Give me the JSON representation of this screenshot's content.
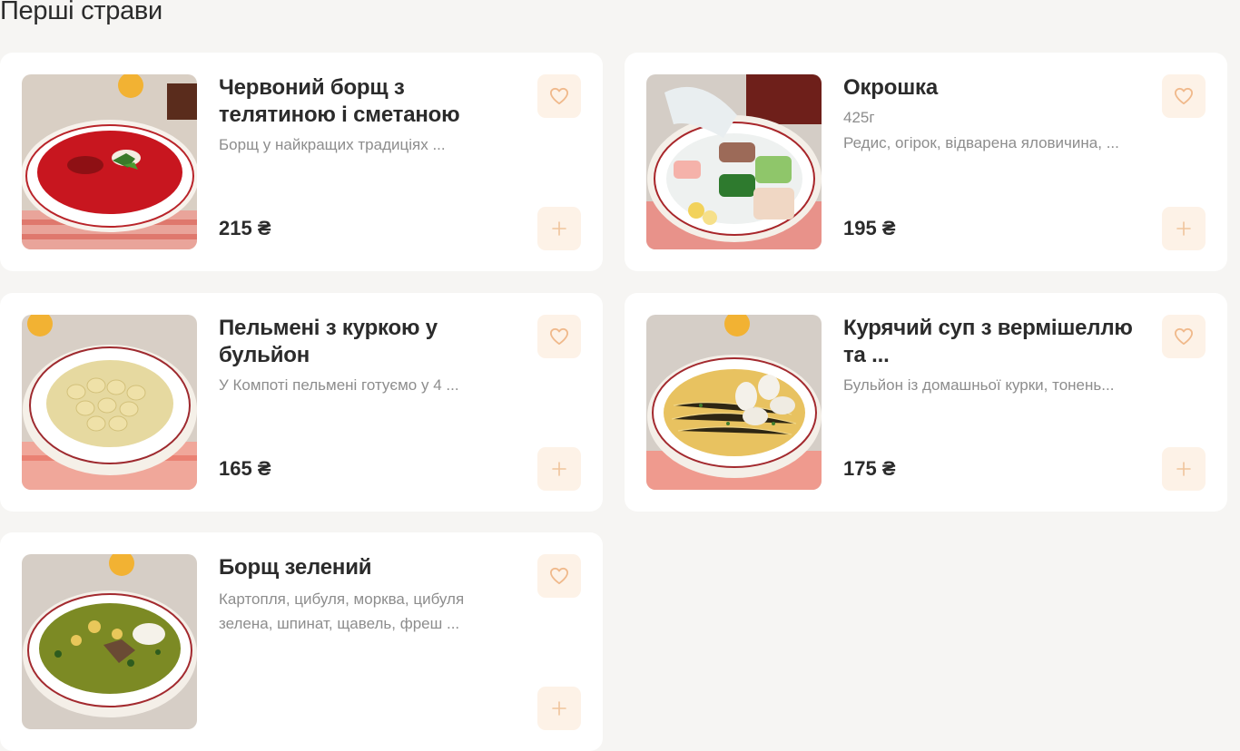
{
  "section": {
    "title": "Перші страви"
  },
  "icons": {
    "favorite": "heart-icon",
    "add": "plus-icon"
  },
  "colors": {
    "accent": "#f2c7a0",
    "button_bg": "#fdf2e7",
    "muted_text": "#8d8d8d",
    "background": "#f6f5f3"
  },
  "dishes": [
    {
      "name": "Червоний борщ з телятиною і сметаною",
      "weight": "",
      "description": "Борщ у найкращих традиціях ...",
      "price": "215 ₴"
    },
    {
      "name": "Окрошка",
      "weight": "425г",
      "description": "Редис, огірок, відварена яловичина, ...",
      "price": "195 ₴"
    },
    {
      "name": "Пельмені з куркою у бульйон",
      "weight": "",
      "description": "У Компоті пельмені готуємо у 4 ...",
      "price": "165 ₴"
    },
    {
      "name": "Курячий суп з вермішеллю та ...",
      "weight": "",
      "description": "Бульйон із домашньої курки, тонень...",
      "price": "175 ₴"
    },
    {
      "name": "Борщ зелений",
      "weight": "",
      "description": "Картопля, цибуля, морква, цибуля зелена, шпинат, щавель, фреш ...",
      "price": ""
    }
  ]
}
